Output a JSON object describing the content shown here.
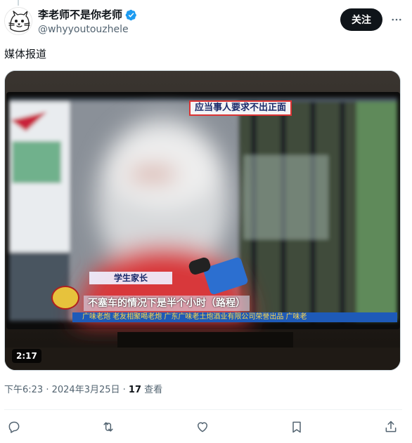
{
  "author": {
    "display_name": "李老师不是你老师",
    "handle": "@whyyoutouzhele",
    "verified": true
  },
  "follow_label": "关注",
  "tweet": {
    "text": "媒体报道"
  },
  "video": {
    "duration": "2:17",
    "caption_top": "应当事人要求不出正面",
    "caption_name": "学生家长",
    "caption_main": "不塞车的情况下是半个小时（路程）",
    "ticker_text": "广味老炮   老友相聚喝老炮   广东广味老土炮酒业有限公司荣誉出品   广味老"
  },
  "meta": {
    "time": "下午6:23",
    "date": "2024年3月25日",
    "views_count": "17",
    "views_label": "查看"
  },
  "colors": {
    "accent": "#1d9bf0",
    "text_secondary": "#536471",
    "follow_bg": "#0f1419"
  },
  "icons": {
    "verified": "verified-badge-icon",
    "more": "more-icon",
    "reply": "reply-icon",
    "retweet": "retweet-icon",
    "like": "like-icon",
    "bookmark": "bookmark-icon",
    "share": "share-icon"
  }
}
